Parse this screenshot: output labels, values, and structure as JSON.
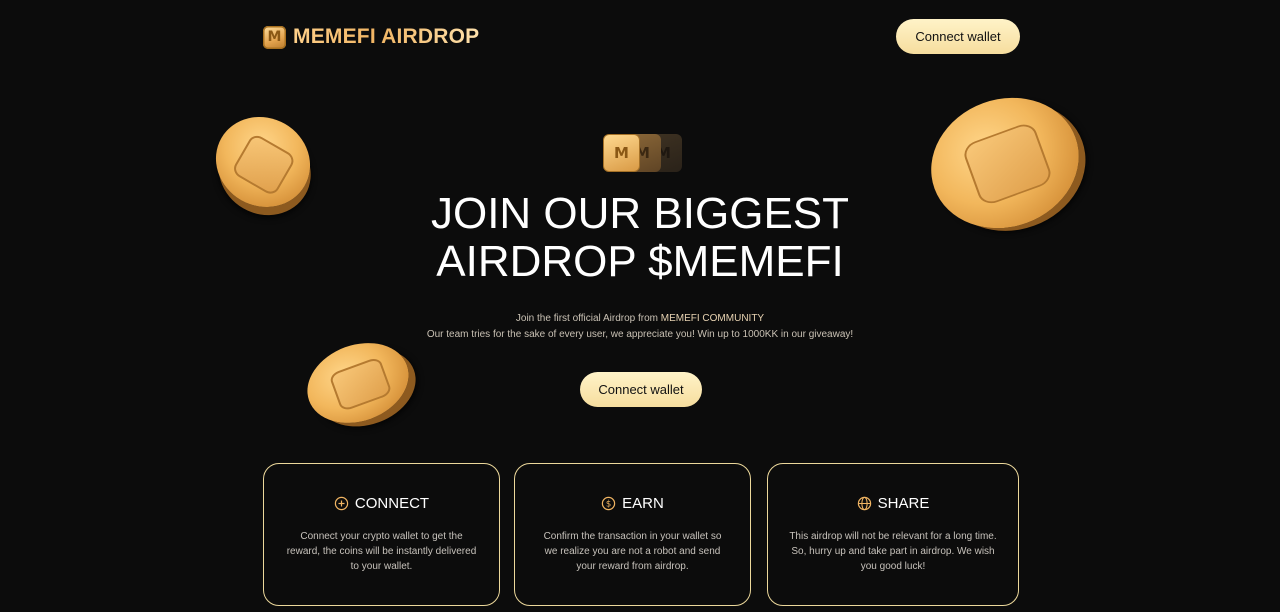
{
  "header": {
    "logo_text": "MEMEFI AIRDROP",
    "logo_icon": "memefi-logo-icon",
    "connect_label": "Connect wallet"
  },
  "hero": {
    "title_line1": "JOIN OUR BIGGEST",
    "title_line2": "AIRDROP $MEMEFI",
    "sub_line1_prefix": "Join the first official Airdrop from ",
    "sub_line1_brand": "MEMEFI COMMUNITY",
    "sub_line2": "Our team tries for the sake of every user, we appreciate you! Win up to 1000KK in our giveaway!",
    "connect_label": "Connect wallet"
  },
  "cards": [
    {
      "title": "CONNECT",
      "icon": "plus-circle-icon",
      "text": "Connect your crypto wallet to get the reward, the coins will be instantly delivered to your wallet."
    },
    {
      "title": "EARN",
      "icon": "dollar-circle-icon",
      "text": "Confirm the transaction in your wallet so we realize you are not a robot and send your reward from airdrop."
    },
    {
      "title": "SHARE",
      "icon": "globe-icon",
      "text": "This airdrop will not be relevant for a long time. So, hurry up and take part in airdrop. We wish you good luck!"
    }
  ],
  "colors": {
    "background": "#0c0c0c",
    "accent_gold": "#f1b563",
    "button_fill": "#f6dd9e",
    "card_border": "#ecd89b"
  }
}
